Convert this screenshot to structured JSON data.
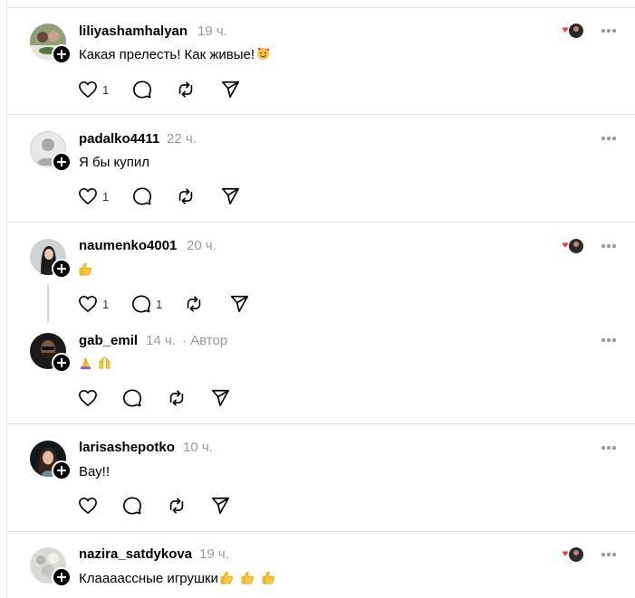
{
  "posts": [
    {
      "username": "liliyashamhalyan",
      "time": "19 ч.",
      "text": "Какая прелесть! Как живые!",
      "likes": "1"
    },
    {
      "username": "padalko4411",
      "time": "22 ч.",
      "text": "Я бы купил",
      "likes": "1"
    },
    {
      "username": "naumenko4001",
      "time": "20 ч.",
      "text": "",
      "likes": "1",
      "replies": "1"
    },
    {
      "username": "gab_emil",
      "time": "14 ч.",
      "author_label": "· Автор",
      "text": ""
    },
    {
      "username": "larisashepotko",
      "time": "10 ч.",
      "text": "Вау!!"
    },
    {
      "username": "nazira_satdykova",
      "time": "19 ч.",
      "text": "Клаааасcные игрушки"
    }
  ],
  "icons": {
    "like": "heart-icon",
    "reply": "comment-icon",
    "repost": "repost-icon",
    "share": "share-icon",
    "more": "more-icon",
    "follow": "plus-icon",
    "liked_by": "liked-by-author-icon"
  },
  "colors": {
    "like_red": "#ff3040",
    "muted": "#999999",
    "divider": "#e0e0e0"
  }
}
